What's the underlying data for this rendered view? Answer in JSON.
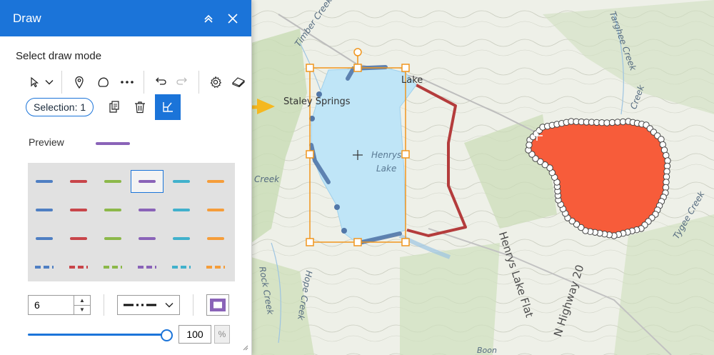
{
  "panel": {
    "title": "Draw",
    "section_label": "Select draw mode",
    "selection_label": "Selection: 1",
    "preview_label": "Preview",
    "width_value": "6",
    "opacity_value": "100",
    "opacity_unit": "%"
  },
  "map": {
    "labels": {
      "staley_springs": "Staley Springs",
      "lake": "Lake",
      "henrys": "Henrys",
      "lake2": "Lake",
      "timber_creek": "Timber Creek",
      "targhee_creek": "Targhee Creek",
      "tygee_creek": "Tygee Creek",
      "henrys_lake_flat": "Henrys Lake Flat",
      "n_highway_20": "N Highway 20",
      "rock_creek": "Rock Creek",
      "hope_creek": "Hope Creek",
      "creek_left": "Creek",
      "creek_right": "Creek",
      "boon": "Boon"
    }
  },
  "colors": {
    "accent": "#1b74d9",
    "preview_stroke": "#8a63b8",
    "selection_box": "#f0961e",
    "lake_fill": "#bfe5f7",
    "lake_outline": "#b43c3c",
    "polygon_fill": "#f75c3a",
    "arrow": "#f5b820"
  },
  "icons": [
    "collapse-icon",
    "close-icon",
    "pointer-icon",
    "chevron-down-icon",
    "point-icon",
    "polygon-icon",
    "more-icon",
    "undo-icon",
    "redo-icon",
    "settings-icon",
    "eraser-icon",
    "copy-icon",
    "trash-icon",
    "edit-vertices-icon",
    "spinner-up-icon",
    "spinner-down-icon",
    "color-swatch-icon"
  ]
}
